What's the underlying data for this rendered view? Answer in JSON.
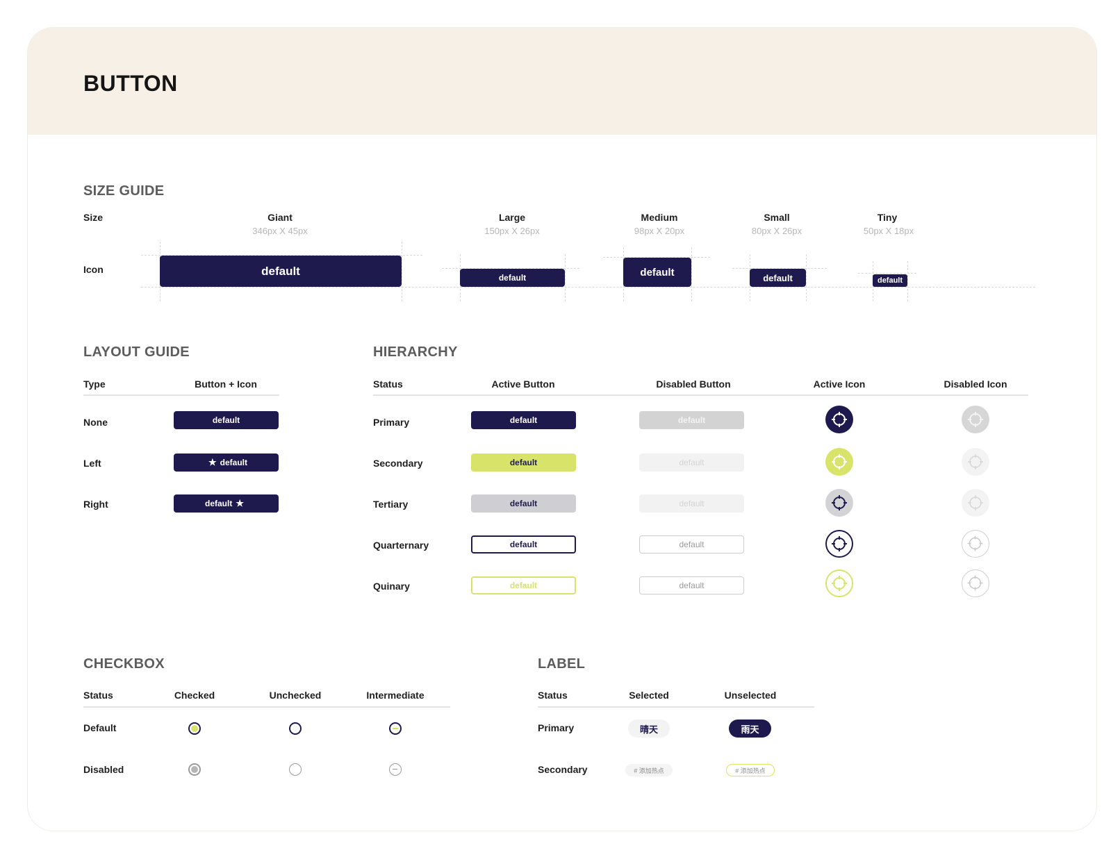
{
  "page": {
    "title": "BUTTON"
  },
  "size_guide": {
    "title": "SIZE GUIDE",
    "row_size_label": "Size",
    "row_icon_label": "Icon",
    "sizes": [
      {
        "name": "Giant",
        "dims": "346px X 45px",
        "button_label": "default"
      },
      {
        "name": "Large",
        "dims": "150px X 26px",
        "button_label": "default"
      },
      {
        "name": "Medium",
        "dims": "98px X 20px",
        "button_label": "default"
      },
      {
        "name": "Small",
        "dims": "80px X 26px",
        "button_label": "default"
      },
      {
        "name": "Tiny",
        "dims": "50px X 18px",
        "button_label": "default"
      }
    ]
  },
  "layout_guide": {
    "title": "LAYOUT GUIDE",
    "headers": {
      "type": "Type",
      "button_icon": "Button + Icon"
    },
    "rows": [
      {
        "type": "None",
        "label": "default"
      },
      {
        "type": "Left",
        "label": "default",
        "icon": "star-icon"
      },
      {
        "type": "Right",
        "label": "default",
        "icon": "star-icon"
      }
    ]
  },
  "hierarchy": {
    "title": "HIERARCHY",
    "headers": {
      "status": "Status",
      "active_button": "Active Button",
      "disabled_button": "Disabled Button",
      "active_icon": "Active Icon",
      "disabled_icon": "Disabled Icon"
    },
    "rows": [
      {
        "status": "Primary",
        "active_label": "default",
        "disabled_label": "default"
      },
      {
        "status": "Secondary",
        "active_label": "default",
        "disabled_label": "default"
      },
      {
        "status": "Tertiary",
        "active_label": "default",
        "disabled_label": "default"
      },
      {
        "status": "Quarternary",
        "active_label": "default",
        "disabled_label": "default"
      },
      {
        "status": "Quinary",
        "active_label": "default",
        "disabled_label": "default"
      }
    ],
    "icon": "crosshair-icon"
  },
  "checkbox": {
    "title": "CHECKBOX",
    "headers": {
      "status": "Status",
      "checked": "Checked",
      "unchecked": "Unchecked",
      "intermediate": "Intermediate"
    },
    "rows": [
      {
        "status": "Default"
      },
      {
        "status": "Disabled"
      }
    ]
  },
  "label": {
    "title": "LABEL",
    "headers": {
      "status": "Status",
      "selected": "Selected",
      "unselected": "Unselected"
    },
    "rows": [
      {
        "status": "Primary",
        "selected": "晴天",
        "unselected": "雨天"
      },
      {
        "status": "Secondary",
        "selected": "# 添加热点",
        "unselected": "# 添加热点"
      }
    ]
  },
  "colors": {
    "navy": "#1e1a4d",
    "lime": "#d8e36a",
    "header_bg": "#f7f0e7",
    "disabled_gray": "#d3d3d3"
  }
}
